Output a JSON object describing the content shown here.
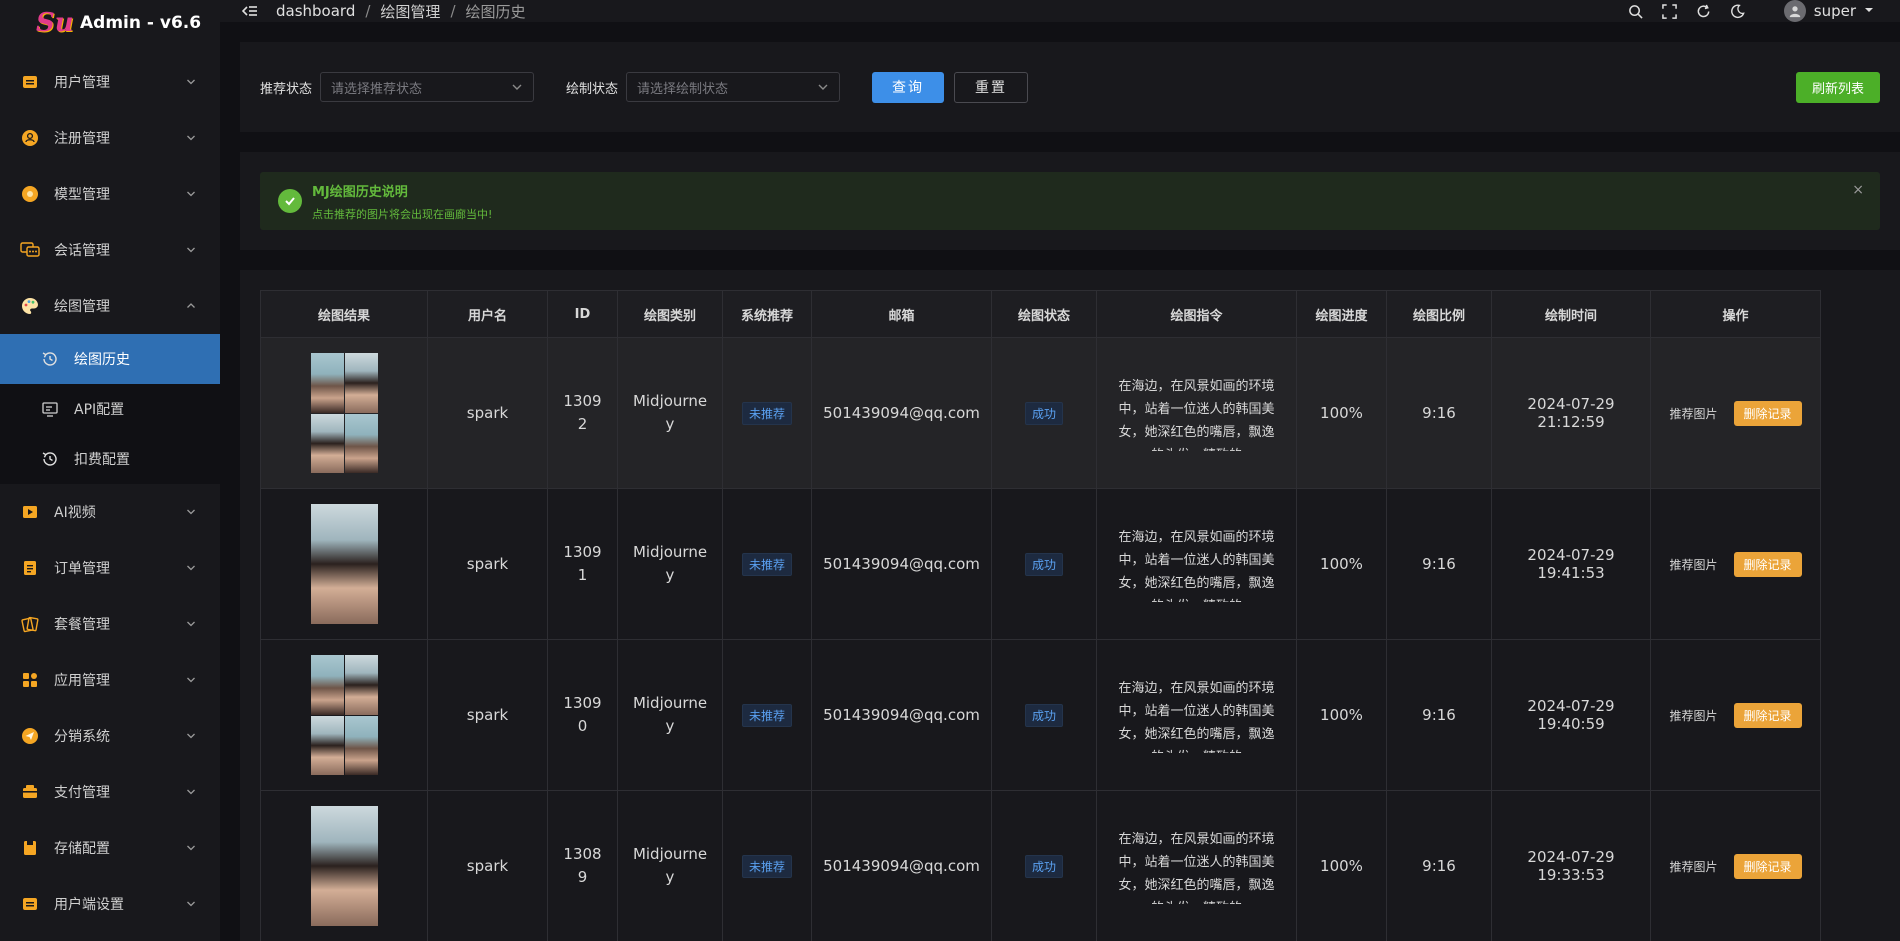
{
  "app": {
    "title": "Admin - v6.6",
    "logo_text": "Su"
  },
  "sidebar": {
    "items": [
      {
        "label": "用户管理",
        "icon": "user-card-icon",
        "color": "#f5a623",
        "expanded": false
      },
      {
        "label": "注册管理",
        "icon": "register-icon",
        "color": "#f5a623",
        "expanded": false
      },
      {
        "label": "模型管理",
        "icon": "model-icon",
        "color": "#f5a623",
        "expanded": false
      },
      {
        "label": "会话管理",
        "icon": "chat-icon",
        "color": "#f5a623",
        "expanded": false
      },
      {
        "label": "绘图管理",
        "icon": "palette-icon",
        "color": "#f5a623",
        "expanded": true
      },
      {
        "label": "AI视频",
        "icon": "video-icon",
        "color": "#f5a623",
        "expanded": false
      },
      {
        "label": "订单管理",
        "icon": "order-icon",
        "color": "#f5a623",
        "expanded": false
      },
      {
        "label": "套餐管理",
        "icon": "package-icon",
        "color": "#f5a623",
        "expanded": false
      },
      {
        "label": "应用管理",
        "icon": "apps-icon",
        "color": "#f5a623",
        "expanded": false
      },
      {
        "label": "分销系统",
        "icon": "distribution-icon",
        "color": "#f5a623",
        "expanded": false
      },
      {
        "label": "支付管理",
        "icon": "payment-icon",
        "color": "#f5a623",
        "expanded": false
      },
      {
        "label": "存储配置",
        "icon": "storage-icon",
        "color": "#f5a623",
        "expanded": false
      },
      {
        "label": "用户端设置",
        "icon": "client-settings-icon",
        "color": "#f5a623",
        "expanded": false
      }
    ],
    "submenu": [
      {
        "label": "绘图历史",
        "icon": "history-icon",
        "active": true
      },
      {
        "label": "API配置",
        "icon": "monitor-icon",
        "active": false
      },
      {
        "label": "扣费配置",
        "icon": "history-icon",
        "active": false
      }
    ]
  },
  "header": {
    "breadcrumb": [
      "dashboard",
      "绘图管理",
      "绘图历史"
    ],
    "user": "super"
  },
  "filter": {
    "recommend_label": "推荐状态",
    "recommend_placeholder": "请选择推荐状态",
    "draw_label": "绘制状态",
    "draw_placeholder": "请选择绘制状态",
    "search_btn": "查询",
    "reset_btn": "重置",
    "refresh_btn": "刷新列表"
  },
  "alert": {
    "title": "MJ绘图历史说明",
    "text": "点击推荐的图片将会出现在画廊当中!",
    "close": "×"
  },
  "table": {
    "headers": [
      "绘图结果",
      "用户名",
      "ID",
      "绘图类别",
      "系统推荐",
      "邮箱",
      "绘图状态",
      "绘图指令",
      "绘图进度",
      "绘图比例",
      "绘制时间",
      "操作"
    ],
    "rows": [
      {
        "grid": true,
        "username": "spark",
        "id": "13092",
        "category": "Midjourney",
        "recommend": "未推荐",
        "email": "501439094@qq.com",
        "status": "成功",
        "prompt": "在海边，在风景如画的环境中，站着一位迷人的韩国美女，她深红色的嘴唇，飘逸的头发，精致的",
        "progress": "100%",
        "ratio": "9:16",
        "time": "2024-07-29 21:12:59",
        "op_recommend": "推荐图片",
        "op_delete": "删除记录"
      },
      {
        "grid": false,
        "username": "spark",
        "id": "13091",
        "category": "Midjourney",
        "recommend": "未推荐",
        "email": "501439094@qq.com",
        "status": "成功",
        "prompt": "在海边，在风景如画的环境中，站着一位迷人的韩国美女，她深红色的嘴唇，飘逸的头发，精致的",
        "progress": "100%",
        "ratio": "9:16",
        "time": "2024-07-29 19:41:53",
        "op_recommend": "推荐图片",
        "op_delete": "删除记录"
      },
      {
        "grid": true,
        "username": "spark",
        "id": "13090",
        "category": "Midjourney",
        "recommend": "未推荐",
        "email": "501439094@qq.com",
        "status": "成功",
        "prompt": "在海边，在风景如画的环境中，站着一位迷人的韩国美女，她深红色的嘴唇，飘逸的头发，精致的",
        "progress": "100%",
        "ratio": "9:16",
        "time": "2024-07-29 19:40:59",
        "op_recommend": "推荐图片",
        "op_delete": "删除记录"
      },
      {
        "grid": false,
        "username": "spark",
        "id": "13089",
        "category": "Midjourney",
        "recommend": "未推荐",
        "email": "501439094@qq.com",
        "status": "成功",
        "prompt": "在海边，在风景如画的环境中，站着一位迷人的韩国美女，她深红色的嘴唇，飘逸的头发，精致的",
        "progress": "100%",
        "ratio": "9:16",
        "time": "2024-07-29 19:33:53",
        "op_recommend": "推荐图片",
        "op_delete": "删除记录"
      }
    ]
  }
}
